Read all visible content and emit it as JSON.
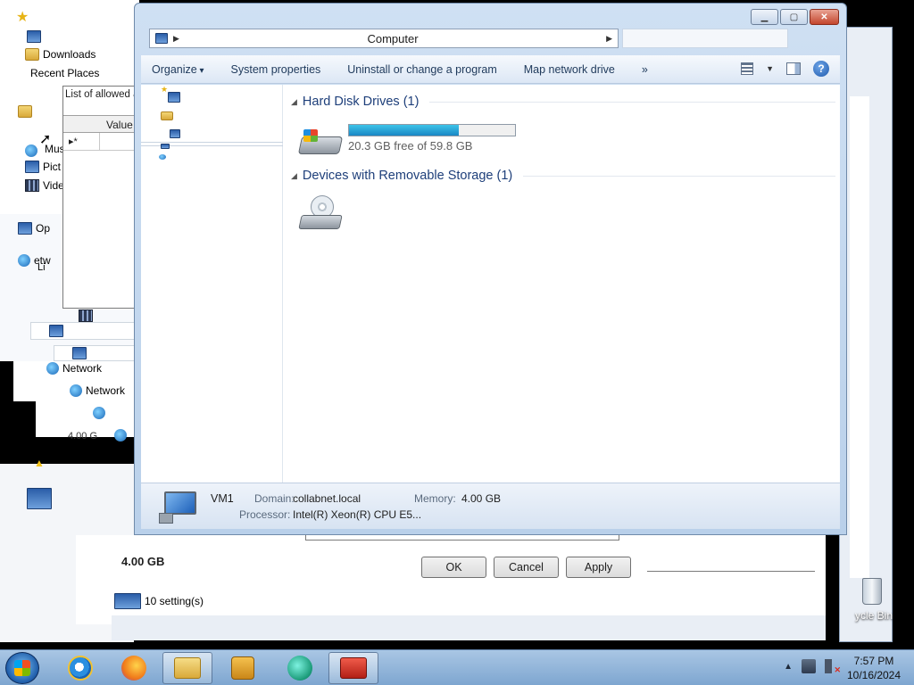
{
  "background": {
    "favorites_items": [
      {
        "label": "Downloads"
      },
      {
        "label": "Recent Places"
      }
    ],
    "allowed_list_label": "List of allowed a",
    "value_header": "Value",
    "new_row_marker": "▸*",
    "fragments": {
      "music": "Mus",
      "pictures": "Pict",
      "videos": "Vide",
      "op": "Op",
      "etw": "etw",
      "li": "Li",
      "network_1": "Network",
      "network_2": "Network",
      "memory_small": "4.00 G",
      "memory_large": "4.00 GB",
      "settings": "10 setting(s)",
      "recycle_bin": "ycle Bin"
    },
    "dialog_buttons": {
      "ok": "OK",
      "cancel": "Cancel",
      "apply": "Apply"
    }
  },
  "window": {
    "address": "Computer",
    "toolbar": {
      "organize": "Organize",
      "system_properties": "System properties",
      "uninstall": "Uninstall or change a program",
      "map_drive": "Map network drive",
      "more": "»"
    },
    "groups": [
      {
        "title": "Hard Disk Drives (1)"
      },
      {
        "title": "Devices with Removable Storage (1)"
      }
    ],
    "drive": {
      "free_text": "20.3 GB free of 59.8 GB",
      "used_fraction": 0.66
    },
    "details": {
      "name": "VM1",
      "domain_label": "Domain:",
      "domain_value": "collabnet.local",
      "memory_label": "Memory:",
      "memory_value": "4.00 GB",
      "processor_label": "Processor:",
      "processor_value": "Intel(R) Xeon(R) CPU E5..."
    }
  },
  "taskbar": {
    "apps": [
      {
        "icon": "internet-explorer-icon"
      },
      {
        "icon": "firefox-icon"
      },
      {
        "icon": "windows-explorer-icon",
        "active": true
      },
      {
        "icon": "media-player-icon"
      },
      {
        "icon": "green-app-icon"
      },
      {
        "icon": "toolbox-icon",
        "active": true
      }
    ],
    "time": "7:57 PM",
    "date": "10/16/2024"
  }
}
